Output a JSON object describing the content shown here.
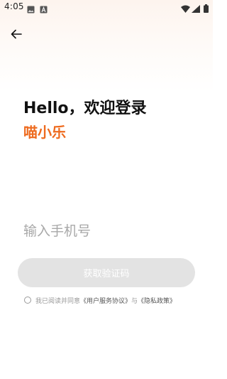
{
  "status_bar": {
    "time": "4:05",
    "icons": [
      "image-icon",
      "a-icon",
      "wifi-icon",
      "signal-icon",
      "battery-icon"
    ]
  },
  "nav": {
    "back_icon": "arrow-left-icon"
  },
  "login": {
    "greeting": "Hello，欢迎登录",
    "app_name": "喵小乐",
    "phone_placeholder": "输入手机号",
    "phone_value": "",
    "code_button_label": "获取验证码"
  },
  "agreement": {
    "prefix": "我已阅读并同意",
    "user_agreement": "《用户服务协议》",
    "conjunction": "与",
    "privacy_policy": "《隐私政策》",
    "checked": false
  },
  "colors": {
    "accent": "#ee6b1f",
    "button_disabled": "#e3e3e3",
    "placeholder": "#a8a8a8"
  }
}
